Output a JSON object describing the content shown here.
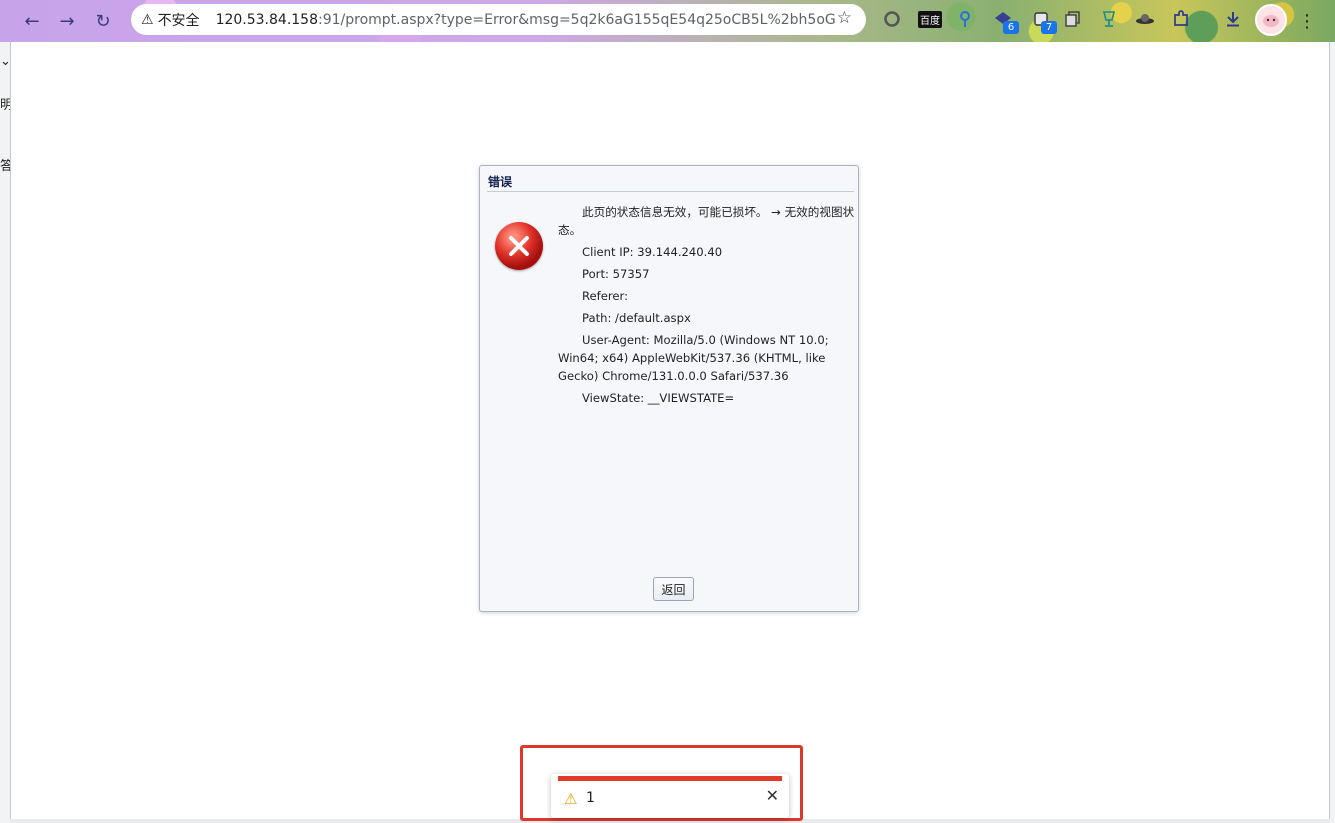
{
  "browser": {
    "security_label": "不安全",
    "url_host": "120.53.84.158",
    "url_rest": ":91/prompt.aspx?type=Error&msg=5q2k6aG155qE54q25oCB5L%2bh5oGv...",
    "extensions": [
      {
        "icon": "circle-extension-icon"
      },
      {
        "label": "百度"
      },
      {
        "icon": "pin-extension-icon"
      },
      {
        "icon": "shield-extension-icon",
        "badge": "6"
      },
      {
        "icon": "square-extension-icon",
        "badge": "7"
      },
      {
        "icon": "copy-extension-icon"
      },
      {
        "icon": "cup-extension-icon"
      },
      {
        "icon": "saucer-extension-icon"
      },
      {
        "icon": "puzzle-extensions-icon"
      },
      {
        "icon": "download-icon"
      }
    ]
  },
  "side_fragments": [
    "⌄",
    "明",
    "答"
  ],
  "dialog": {
    "title": "错误",
    "lines": [
      "此页的状态信息无效，可能已损坏。 → 无效的视图状态。",
      "Client IP: 39.144.240.40",
      "Port: 57357",
      "Referer:",
      "Path: /default.aspx",
      "User-Agent: Mozilla/5.0 (Windows NT 10.0; Win64; x64) AppleWebKit/537.36 (KHTML, like Gecko) Chrome/131.0.0.0 Safari/537.36",
      "ViewState: __VIEWSTATE="
    ],
    "back_label": "返回"
  },
  "toast": {
    "text": "1",
    "close": "✕"
  },
  "colors": {
    "toast_bar": "#e23a2a",
    "highlight": "#e0372c",
    "dialog_title": "#15224f"
  }
}
